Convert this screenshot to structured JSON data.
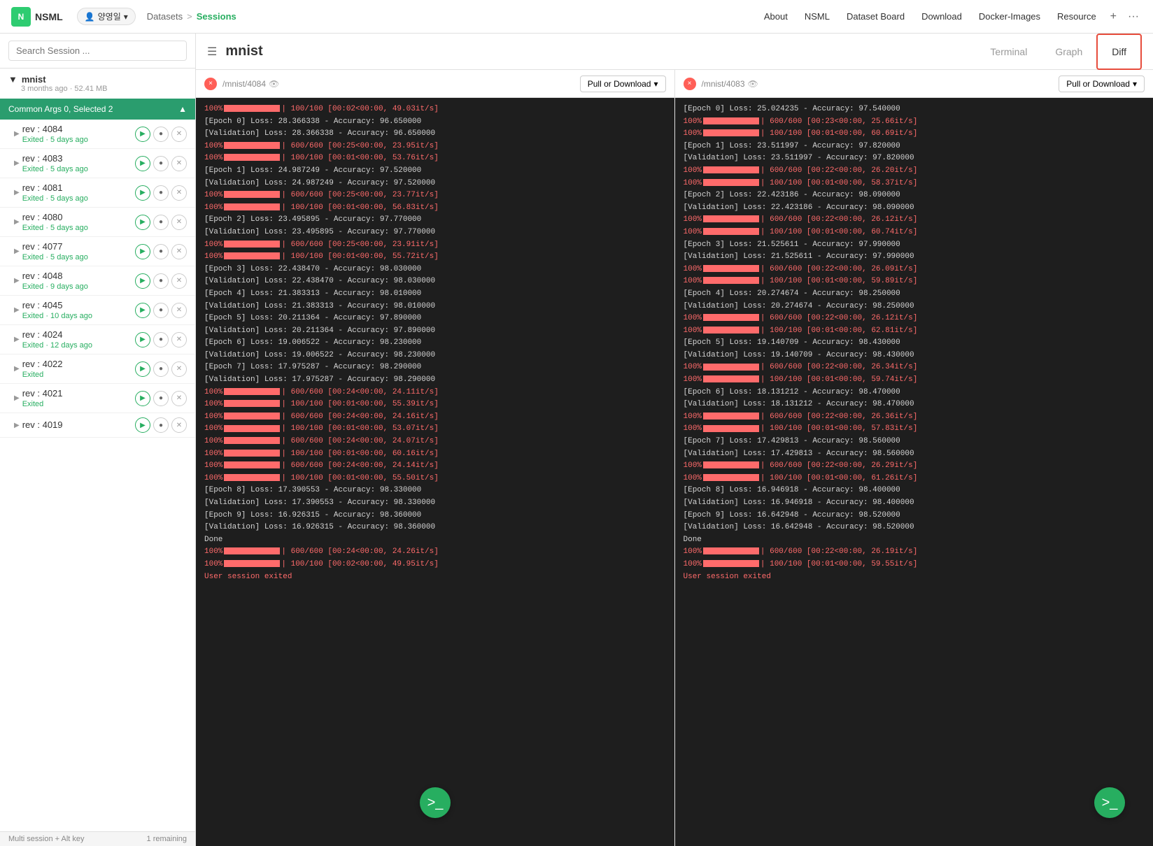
{
  "topnav": {
    "logo_text": "N",
    "brand": "NSML",
    "user_name": "양영일",
    "breadcrumb_parent": "Datasets",
    "breadcrumb_sep": ">",
    "breadcrumb_active": "Sessions",
    "links": [
      "About",
      "NSML",
      "Dataset Board",
      "Download",
      "Docker-Images",
      "Resource"
    ],
    "plus_icon": "+",
    "more_icon": "···"
  },
  "sidebar": {
    "search_placeholder": "Search Session ...",
    "group_name": "mnist",
    "group_meta": "3 months ago · 52.41 MB",
    "common_args_label": "Common Args 0, Selected 2",
    "collapse_icon": "▲",
    "sessions": [
      {
        "id": "rev : 4084",
        "status": "Exited",
        "time": "5 days ago"
      },
      {
        "id": "rev : 4083",
        "status": "Exited",
        "time": "5 days ago"
      },
      {
        "id": "rev : 4081",
        "status": "Exited",
        "time": "5 days ago"
      },
      {
        "id": "rev : 4080",
        "status": "Exited",
        "time": "5 days ago"
      },
      {
        "id": "rev : 4077",
        "status": "Exited",
        "time": "5 days ago"
      },
      {
        "id": "rev : 4048",
        "status": "Exited",
        "time": "9 days ago"
      },
      {
        "id": "rev : 4045",
        "status": "Exited",
        "time": "10 days ago"
      },
      {
        "id": "rev : 4024",
        "status": "Exited",
        "time": "12 days ago"
      },
      {
        "id": "rev : 4022",
        "status": "Exited",
        "time": ""
      },
      {
        "id": "rev : 4021",
        "status": "Exited",
        "time": ""
      },
      {
        "id": "rev : 4019",
        "status": "",
        "time": ""
      }
    ],
    "bottom_hint": "Multi session + Alt key",
    "bottom_count": "1 remaining"
  },
  "main": {
    "title": "mnist",
    "tabs": [
      {
        "label": "Terminal",
        "active": false
      },
      {
        "label": "Graph",
        "active": false
      },
      {
        "label": "Diff",
        "active": true
      }
    ]
  },
  "panels": [
    {
      "id": "panel_left",
      "path": "/mnist/4084",
      "pull_download_label": "Pull or Download",
      "logs": [
        {
          "type": "progress",
          "text": "100%|██████████| 100/100 [00:02<00:00, 49.03it/s]"
        },
        {
          "type": "normal",
          "text": "[Epoch 0] Loss: 28.366338 - Accuracy: 96.650000"
        },
        {
          "type": "normal",
          "text": "[Validation] Loss: 28.366338 - Accuracy: 96.650000"
        },
        {
          "type": "progress",
          "text": "100%|██████████| 600/600 [00:25<00:00, 23.95it/s]"
        },
        {
          "type": "progress",
          "text": "100%|██████████| 100/100 [00:01<00:00, 53.76it/s]"
        },
        {
          "type": "normal",
          "text": "[Epoch 1] Loss: 24.987249 - Accuracy: 97.520000"
        },
        {
          "type": "normal",
          "text": "[Validation] Loss: 24.987249 - Accuracy: 97.520000"
        },
        {
          "type": "progress",
          "text": "100%|██████████| 600/600 [00:25<00:00, 23.77it/s]"
        },
        {
          "type": "progress",
          "text": "100%|██████████| 100/100 [00:01<00:00, 56.83it/s]"
        },
        {
          "type": "normal",
          "text": "[Epoch 2] Loss: 23.495895 - Accuracy: 97.770000"
        },
        {
          "type": "normal",
          "text": "[Validation] Loss: 23.495895 - Accuracy: 97.770000"
        },
        {
          "type": "progress",
          "text": "100%|██████████| 600/600 [00:25<00:00, 23.91it/s]"
        },
        {
          "type": "progress",
          "text": "100%|██████████| 100/100 [00:01<00:00, 55.72it/s]"
        },
        {
          "type": "normal",
          "text": "[Epoch 3] Loss: 22.438470 - Accuracy: 98.030000"
        },
        {
          "type": "normal",
          "text": "[Validation] Loss: 22.438470 - Accuracy: 98.030000"
        },
        {
          "type": "normal",
          "text": "[Epoch 4] Loss: 21.383313 - Accuracy: 98.010000"
        },
        {
          "type": "normal",
          "text": "[Validation] Loss: 21.383313 - Accuracy: 98.010000"
        },
        {
          "type": "normal",
          "text": "[Epoch 5] Loss: 20.211364 - Accuracy: 97.890000"
        },
        {
          "type": "normal",
          "text": "[Validation] Loss: 20.211364 - Accuracy: 97.890000"
        },
        {
          "type": "normal",
          "text": "[Epoch 6] Loss: 19.006522 - Accuracy: 98.230000"
        },
        {
          "type": "normal",
          "text": "[Validation] Loss: 19.006522 - Accuracy: 98.230000"
        },
        {
          "type": "normal",
          "text": "[Epoch 7] Loss: 17.975287 - Accuracy: 98.290000"
        },
        {
          "type": "normal",
          "text": "[Validation] Loss: 17.975287 - Accuracy: 98.290000"
        },
        {
          "type": "progress",
          "text": "100%|██████████| 600/600 [00:24<00:00, 24.11it/s]"
        },
        {
          "type": "progress",
          "text": "100%|██████████| 100/100 [00:01<00:00, 55.39it/s]"
        },
        {
          "type": "progress",
          "text": "100%|██████████| 600/600 [00:24<00:00, 24.16it/s]"
        },
        {
          "type": "progress",
          "text": "100%|██████████| 100/100 [00:01<00:00, 53.07it/s]"
        },
        {
          "type": "progress",
          "text": "100%|██████████| 600/600 [00:24<00:00, 24.07it/s]"
        },
        {
          "type": "progress",
          "text": "100%|██████████| 100/100 [00:01<00:00, 60.16it/s]"
        },
        {
          "type": "progress",
          "text": "100%|██████████| 600/600 [00:24<00:00, 24.14it/s]"
        },
        {
          "type": "progress",
          "text": "100%|██████████| 100/100 [00:01<00:00, 55.50it/s]"
        },
        {
          "type": "normal",
          "text": "[Epoch 8] Loss: 17.390553 - Accuracy: 98.330000"
        },
        {
          "type": "normal",
          "text": "[Validation] Loss: 17.390553 - Accuracy: 98.330000"
        },
        {
          "type": "normal",
          "text": "[Epoch 9] Loss: 16.926315 - Accuracy: 98.360000"
        },
        {
          "type": "normal",
          "text": "[Validation] Loss: 16.926315 - Accuracy: 98.360000"
        },
        {
          "type": "normal",
          "text": "Done"
        },
        {
          "type": "progress",
          "text": "100%|██████████| 600/600 [00:24<00:00, 24.26it/s]"
        },
        {
          "type": "progress",
          "text": "100%|██████████| 100/100 [00:02<00:00, 49.95it/s]"
        },
        {
          "type": "error",
          "text": "User session exited"
        }
      ]
    },
    {
      "id": "panel_right",
      "path": "/mnist/4083",
      "pull_download_label": "Pull or Download",
      "logs": [
        {
          "type": "normal",
          "text": "[Epoch 0] Loss: 25.024235 - Accuracy: 97.540000"
        },
        {
          "type": "progress",
          "text": "100%|██████████| 600/600 [00:23<00:00, 25.66it/s]"
        },
        {
          "type": "progress",
          "text": "100%|██████████| 100/100 [00:01<00:00, 60.69it/s]"
        },
        {
          "type": "normal",
          "text": "[Epoch 1] Loss: 23.511997 - Accuracy: 97.820000"
        },
        {
          "type": "normal",
          "text": "[Validation] Loss: 23.511997 - Accuracy: 97.820000"
        },
        {
          "type": "progress",
          "text": "100%|██████████| 600/600 [00:22<00:00, 26.20it/s]"
        },
        {
          "type": "progress",
          "text": "100%|██████████| 100/100 [00:01<00:00, 58.37it/s]"
        },
        {
          "type": "normal",
          "text": "[Epoch 2] Loss: 22.423186 - Accuracy: 98.090000"
        },
        {
          "type": "normal",
          "text": "[Validation] Loss: 22.423186 - Accuracy: 98.090000"
        },
        {
          "type": "progress",
          "text": "100%|██████████| 600/600 [00:22<00:00, 26.12it/s]"
        },
        {
          "type": "progress",
          "text": "100%|██████████| 100/100 [00:01<00:00, 60.74it/s]"
        },
        {
          "type": "normal",
          "text": "[Epoch 3] Loss: 21.525611 - Accuracy: 97.990000"
        },
        {
          "type": "normal",
          "text": "[Validation] Loss: 21.525611 - Accuracy: 97.990000"
        },
        {
          "type": "progress",
          "text": "100%|██████████| 600/600 [00:22<00:00, 26.09it/s]"
        },
        {
          "type": "progress",
          "text": "100%|██████████| 100/100 [00:01<00:00, 59.89it/s]"
        },
        {
          "type": "normal",
          "text": "[Epoch 4] Loss: 20.274674 - Accuracy: 98.250000"
        },
        {
          "type": "normal",
          "text": "[Validation] Loss: 20.274674 - Accuracy: 98.250000"
        },
        {
          "type": "progress",
          "text": "100%|██████████| 600/600 [00:22<00:00, 26.12it/s]"
        },
        {
          "type": "progress",
          "text": "100%|██████████| 100/100 [00:01<00:00, 62.81it/s]"
        },
        {
          "type": "normal",
          "text": "[Epoch 5] Loss: 19.140709 - Accuracy: 98.430000"
        },
        {
          "type": "normal",
          "text": "[Validation] Loss: 19.140709 - Accuracy: 98.430000"
        },
        {
          "type": "progress",
          "text": "100%|██████████| 600/600 [00:22<00:00, 26.34it/s]"
        },
        {
          "type": "progress",
          "text": "100%|██████████| 100/100 [00:01<00:00, 59.74it/s]"
        },
        {
          "type": "normal",
          "text": "[Epoch 6] Loss: 18.131212 - Accuracy: 98.470000"
        },
        {
          "type": "normal",
          "text": "[Validation] Loss: 18.131212 - Accuracy: 98.470000"
        },
        {
          "type": "progress",
          "text": "100%|██████████| 600/600 [00:22<00:00, 26.36it/s]"
        },
        {
          "type": "progress",
          "text": "100%|██████████| 100/100 [00:01<00:00, 57.83it/s]"
        },
        {
          "type": "normal",
          "text": "[Epoch 7] Loss: 17.429813 - Accuracy: 98.560000"
        },
        {
          "type": "normal",
          "text": "[Validation] Loss: 17.429813 - Accuracy: 98.560000"
        },
        {
          "type": "progress",
          "text": "100%|██████████| 600/600 [00:22<00:00, 26.29it/s]"
        },
        {
          "type": "progress",
          "text": "100%|██████████| 100/100 [00:01<00:00, 61.26it/s]"
        },
        {
          "type": "normal",
          "text": "[Epoch 8] Loss: 16.946918 - Accuracy: 98.400000"
        },
        {
          "type": "normal",
          "text": "[Validation] Loss: 16.946918 - Accuracy: 98.400000"
        },
        {
          "type": "normal",
          "text": "[Epoch 9] Loss: 16.642948 - Accuracy: 98.520000"
        },
        {
          "type": "normal",
          "text": "[Validation] Loss: 16.642948 - Accuracy: 98.520000"
        },
        {
          "type": "normal",
          "text": "Done"
        },
        {
          "type": "progress",
          "text": "100%|██████████| 600/600 [00:22<00:00, 26.19it/s]"
        },
        {
          "type": "progress",
          "text": "100%|██████████| 100/100 [00:01<00:00, 59.55it/s]"
        },
        {
          "type": "error",
          "text": "User session exited"
        }
      ]
    }
  ],
  "fab": {
    "icon": ">_"
  },
  "bottom_bar": {
    "hint": "Multi session + Alt key",
    "count": "1 remaining"
  }
}
